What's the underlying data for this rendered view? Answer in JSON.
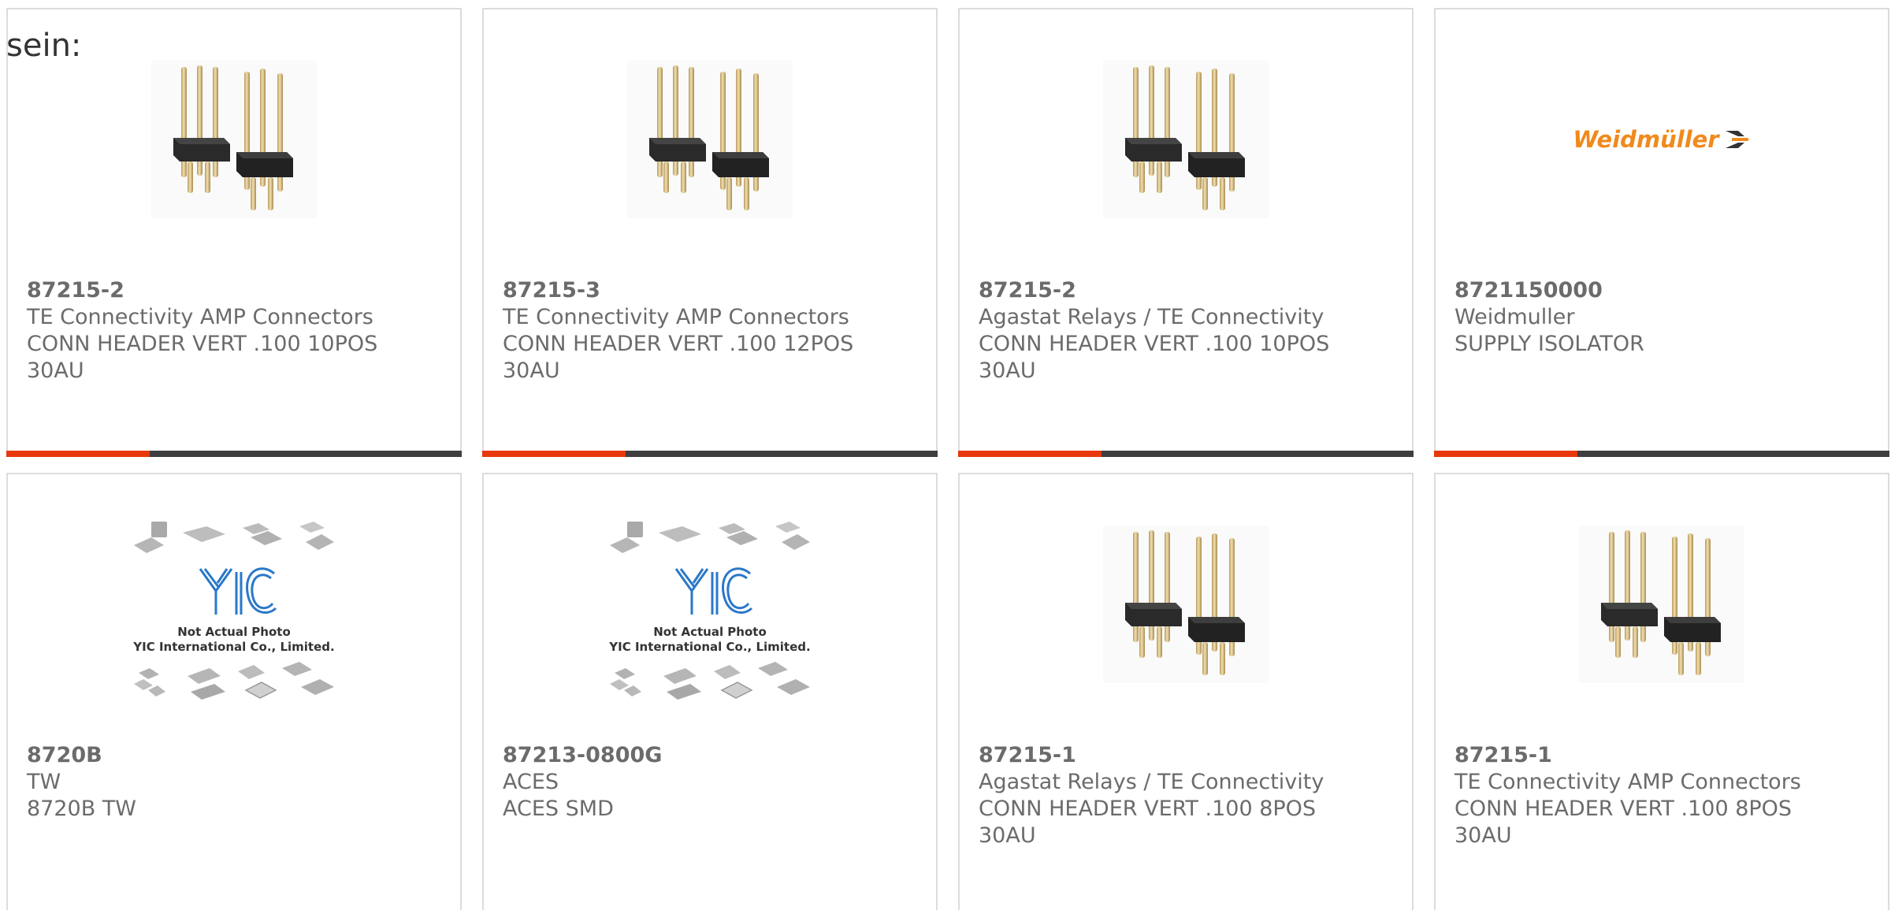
{
  "intro_text": "sein:",
  "accent_color": "#e8380d",
  "bar_color": "#3f3f3f",
  "products": [
    {
      "part_number": "87215-2",
      "manufacturer": "TE Connectivity AMP Connectors",
      "desc_line1": "CONN HEADER VERT .100 10POS",
      "desc_line2": "30AU",
      "image": "pin-header-image"
    },
    {
      "part_number": "87215-3",
      "manufacturer": "TE Connectivity AMP Connectors",
      "desc_line1": "CONN HEADER VERT .100 12POS",
      "desc_line2": "30AU",
      "image": "pin-header-image"
    },
    {
      "part_number": "87215-2",
      "manufacturer": "Agastat Relays / TE Connectivity",
      "desc_line1": "CONN HEADER VERT .100 10POS",
      "desc_line2": "30AU",
      "image": "pin-header-image"
    },
    {
      "part_number": "8721150000",
      "manufacturer": "Weidmuller",
      "desc_line1": "SUPPLY ISOLATOR",
      "desc_line2": "",
      "image": "weidmuller-logo",
      "logo_text": "Weidmüller"
    },
    {
      "part_number": "8720B",
      "manufacturer": "TW",
      "desc_line1": "8720B TW",
      "desc_line2": "",
      "image": "yic-placeholder",
      "placeholder_line1": "Not Actual Photo",
      "placeholder_line2": "YIC International Co., Limited."
    },
    {
      "part_number": "87213-0800G",
      "manufacturer": "ACES",
      "desc_line1": "ACES SMD",
      "desc_line2": "",
      "image": "yic-placeholder",
      "placeholder_line1": "Not Actual Photo",
      "placeholder_line2": "YIC International Co., Limited."
    },
    {
      "part_number": "87215-1",
      "manufacturer": "Agastat Relays / TE Connectivity",
      "desc_line1": "CONN HEADER VERT .100 8POS",
      "desc_line2": "30AU",
      "image": "pin-header-image"
    },
    {
      "part_number": "87215-1",
      "manufacturer": "TE Connectivity AMP Connectors",
      "desc_line1": "CONN HEADER VERT .100 8POS",
      "desc_line2": "30AU",
      "image": "pin-header-image"
    }
  ]
}
